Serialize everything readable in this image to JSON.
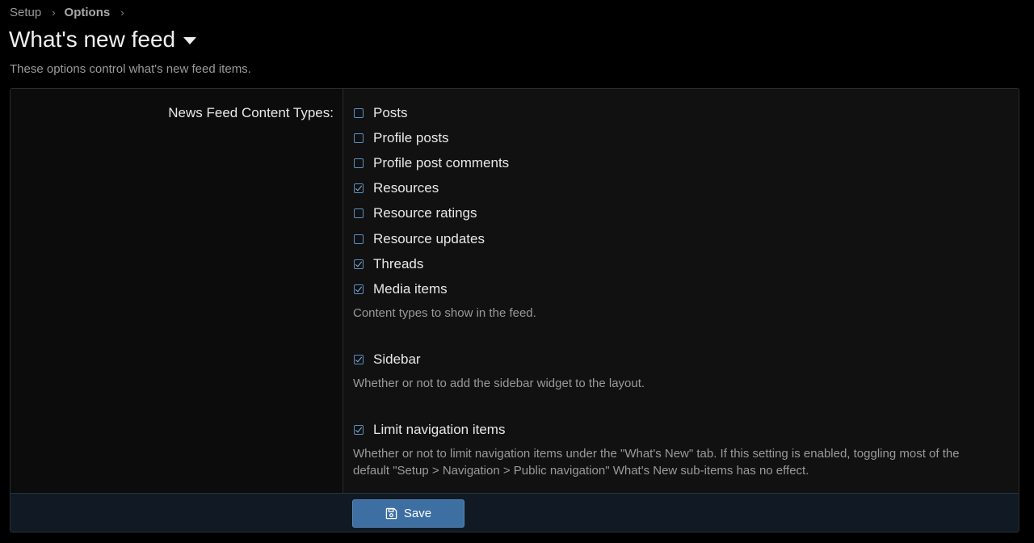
{
  "breadcrumb": {
    "items": [
      "Setup",
      "Options"
    ],
    "separator": "›"
  },
  "title": "What's new feed",
  "subtitle": "These options control what's new feed items.",
  "options": {
    "content_types_label": "News Feed Content Types:",
    "content_types": [
      {
        "label": "Posts",
        "checked": false
      },
      {
        "label": "Profile posts",
        "checked": false
      },
      {
        "label": "Profile post comments",
        "checked": false
      },
      {
        "label": "Resources",
        "checked": true
      },
      {
        "label": "Resource ratings",
        "checked": false
      },
      {
        "label": "Resource updates",
        "checked": false
      },
      {
        "label": "Threads",
        "checked": true
      },
      {
        "label": "Media items",
        "checked": true
      }
    ],
    "content_types_hint": "Content types to show in the feed.",
    "sidebar": {
      "label": "Sidebar",
      "checked": true,
      "hint": "Whether or not to add the sidebar widget to the layout."
    },
    "limit_nav": {
      "label": "Limit navigation items",
      "checked": true,
      "hint_line1": "Whether or not to limit navigation items under the \"What's New\" tab. If this setting is enabled, toggling most of the",
      "hint_line2": "default \"Setup > Navigation > Public navigation\" What's New sub-items has no effect."
    }
  },
  "footer": {
    "save_label": "Save"
  },
  "colors": {
    "accent": "#3d6fa3",
    "checkbox_border": "#5b8fc4"
  },
  "icons": {
    "save": "save-icon",
    "title_menu": "caret-down-icon",
    "breadcrumb_sep": "chevron-right-icon"
  }
}
